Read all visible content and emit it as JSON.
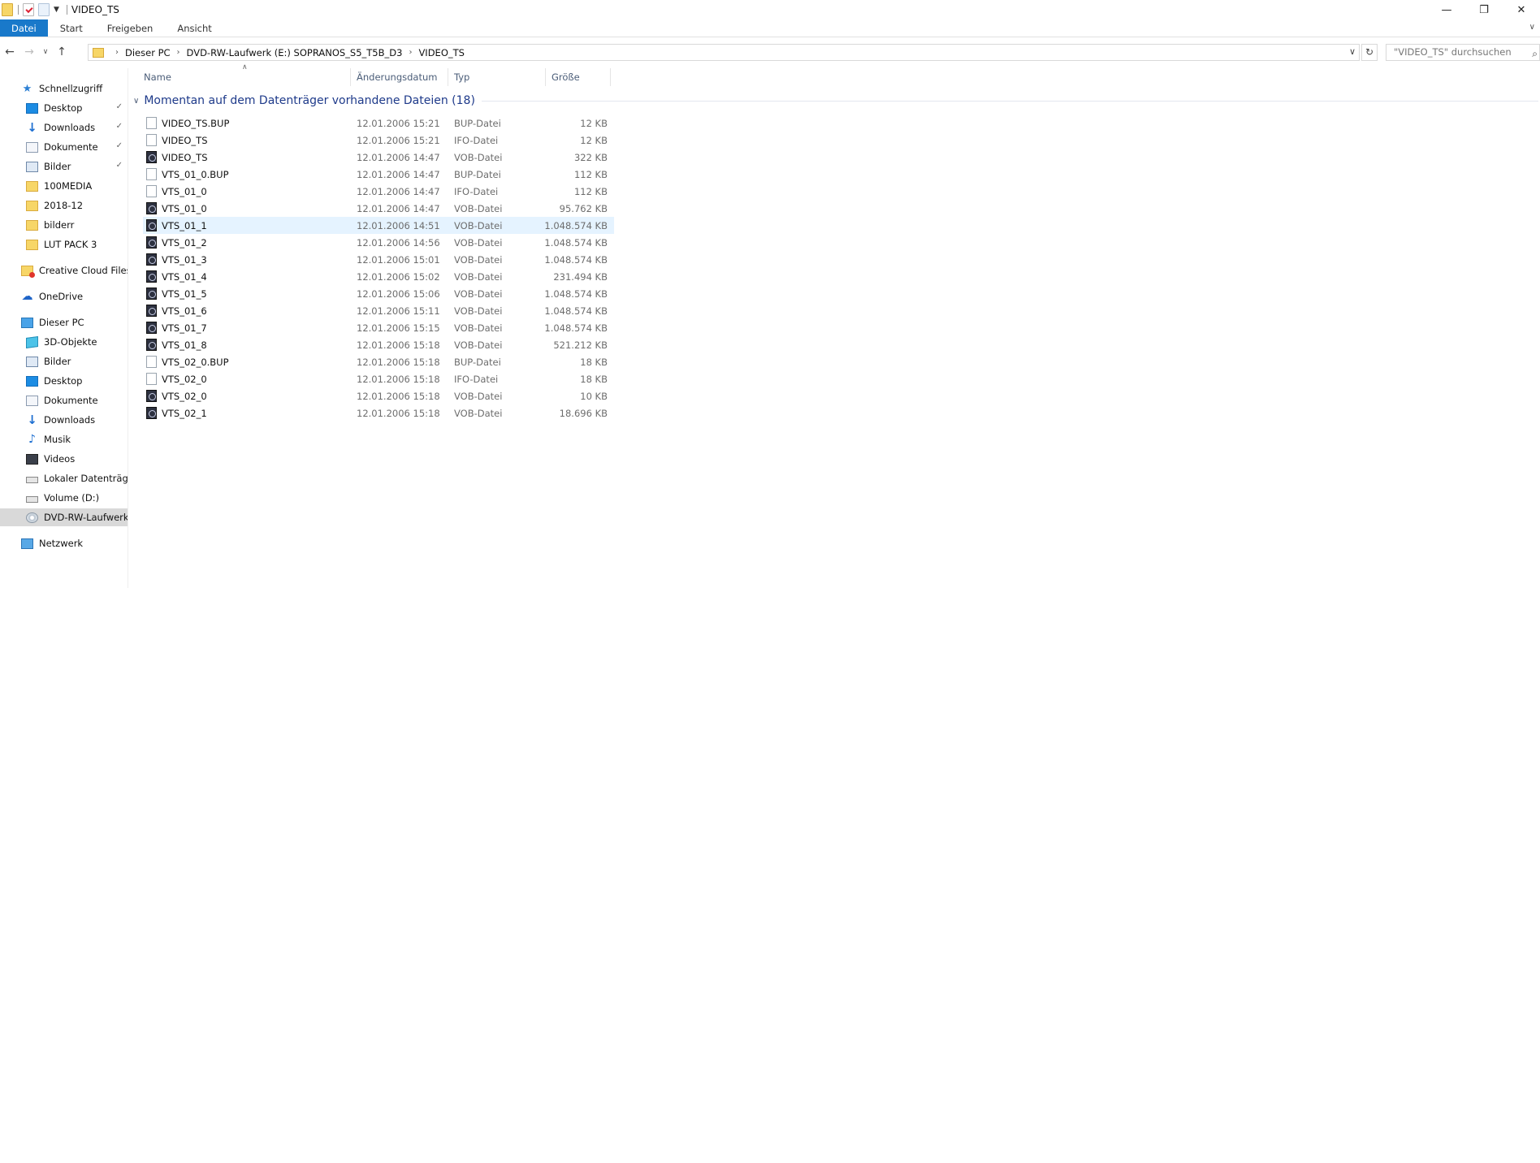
{
  "window": {
    "title": "VIDEO_TS",
    "minimize_glyph": "—",
    "restore_glyph": "❐",
    "close_glyph": "✕"
  },
  "ribbon": {
    "tabs": [
      "Datei",
      "Start",
      "Freigeben",
      "Ansicht"
    ]
  },
  "address": {
    "crumbs": [
      "Dieser PC",
      "DVD-RW-Laufwerk (E:) SOPRANOS_S5_T5B_D3",
      "VIDEO_TS"
    ],
    "search_placeholder": "\"VIDEO_TS\" durchsuchen"
  },
  "nav": {
    "items": [
      {
        "label": "Schnellzugriff",
        "icon": "star-icon",
        "pinned": false
      },
      {
        "label": "Desktop",
        "icon": "desktop-icon",
        "pinned": true
      },
      {
        "label": "Downloads",
        "icon": "download-icon",
        "pinned": true
      },
      {
        "label": "Dokumente",
        "icon": "documents-icon",
        "pinned": true
      },
      {
        "label": "Bilder",
        "icon": "pictures-icon",
        "pinned": true
      },
      {
        "label": "100MEDIA",
        "icon": "folder-icon",
        "pinned": false
      },
      {
        "label": "2018-12",
        "icon": "folder-icon",
        "pinned": false
      },
      {
        "label": "bilderr",
        "icon": "folder-icon",
        "pinned": false
      },
      {
        "label": "LUT PACK 3",
        "icon": "folder-icon",
        "pinned": false
      },
      {
        "label": "Creative Cloud Files",
        "icon": "creative-cloud-icon",
        "pinned": false
      },
      {
        "label": "OneDrive",
        "icon": "onedrive-icon",
        "pinned": false
      },
      {
        "label": "Dieser PC",
        "icon": "computer-icon",
        "pinned": false
      },
      {
        "label": "3D-Objekte",
        "icon": "3d-objects-icon",
        "pinned": false
      },
      {
        "label": "Bilder",
        "icon": "pictures-icon",
        "pinned": false
      },
      {
        "label": "Desktop",
        "icon": "desktop-icon",
        "pinned": false
      },
      {
        "label": "Dokumente",
        "icon": "documents-icon",
        "pinned": false
      },
      {
        "label": "Downloads",
        "icon": "download-icon",
        "pinned": false
      },
      {
        "label": "Musik",
        "icon": "music-icon",
        "pinned": false
      },
      {
        "label": "Videos",
        "icon": "videos-icon",
        "pinned": false
      },
      {
        "label": "Lokaler Datenträger",
        "icon": "local-disk-icon",
        "pinned": false
      },
      {
        "label": "Volume (D:)",
        "icon": "drive-icon",
        "pinned": false
      },
      {
        "label": "DVD-RW-Laufwerk",
        "icon": "dvd-drive-icon",
        "pinned": false,
        "selected": true
      },
      {
        "label": "Netzwerk",
        "icon": "network-icon",
        "pinned": false
      }
    ]
  },
  "columns": {
    "name": "Name",
    "date": "Änderungsdatum",
    "type": "Typ",
    "size": "Größe"
  },
  "group": {
    "label": "Momentan auf dem Datenträger vorhandene Dateien (18)"
  },
  "files": [
    {
      "name": "VIDEO_TS.BUP",
      "date": "12.01.2006 15:21",
      "type": "BUP-Datei",
      "size": "12 KB",
      "icon": "file-icon"
    },
    {
      "name": "VIDEO_TS",
      "date": "12.01.2006 15:21",
      "type": "IFO-Datei",
      "size": "12 KB",
      "icon": "file-icon"
    },
    {
      "name": "VIDEO_TS",
      "date": "12.01.2006 14:47",
      "type": "VOB-Datei",
      "size": "322 KB",
      "icon": "vob-icon"
    },
    {
      "name": "VTS_01_0.BUP",
      "date": "12.01.2006 14:47",
      "type": "BUP-Datei",
      "size": "112 KB",
      "icon": "file-icon"
    },
    {
      "name": "VTS_01_0",
      "date": "12.01.2006 14:47",
      "type": "IFO-Datei",
      "size": "112 KB",
      "icon": "file-icon"
    },
    {
      "name": "VTS_01_0",
      "date": "12.01.2006 14:47",
      "type": "VOB-Datei",
      "size": "95.762 KB",
      "icon": "vob-icon"
    },
    {
      "name": "VTS_01_1",
      "date": "12.01.2006 14:51",
      "type": "VOB-Datei",
      "size": "1.048.574 KB",
      "icon": "vob-icon",
      "selected": true
    },
    {
      "name": "VTS_01_2",
      "date": "12.01.2006 14:56",
      "type": "VOB-Datei",
      "size": "1.048.574 KB",
      "icon": "vob-icon"
    },
    {
      "name": "VTS_01_3",
      "date": "12.01.2006 15:01",
      "type": "VOB-Datei",
      "size": "1.048.574 KB",
      "icon": "vob-icon"
    },
    {
      "name": "VTS_01_4",
      "date": "12.01.2006 15:02",
      "type": "VOB-Datei",
      "size": "231.494 KB",
      "icon": "vob-icon"
    },
    {
      "name": "VTS_01_5",
      "date": "12.01.2006 15:06",
      "type": "VOB-Datei",
      "size": "1.048.574 KB",
      "icon": "vob-icon"
    },
    {
      "name": "VTS_01_6",
      "date": "12.01.2006 15:11",
      "type": "VOB-Datei",
      "size": "1.048.574 KB",
      "icon": "vob-icon"
    },
    {
      "name": "VTS_01_7",
      "date": "12.01.2006 15:15",
      "type": "VOB-Datei",
      "size": "1.048.574 KB",
      "icon": "vob-icon"
    },
    {
      "name": "VTS_01_8",
      "date": "12.01.2006 15:18",
      "type": "VOB-Datei",
      "size": "521.212 KB",
      "icon": "vob-icon"
    },
    {
      "name": "VTS_02_0.BUP",
      "date": "12.01.2006 15:18",
      "type": "BUP-Datei",
      "size": "18 KB",
      "icon": "file-icon"
    },
    {
      "name": "VTS_02_0",
      "date": "12.01.2006 15:18",
      "type": "IFO-Datei",
      "size": "18 KB",
      "icon": "file-icon"
    },
    {
      "name": "VTS_02_0",
      "date": "12.01.2006 15:18",
      "type": "VOB-Datei",
      "size": "10 KB",
      "icon": "vob-icon"
    },
    {
      "name": "VTS_02_1",
      "date": "12.01.2006 15:18",
      "type": "VOB-Datei",
      "size": "18.696 KB",
      "icon": "vob-icon"
    }
  ]
}
